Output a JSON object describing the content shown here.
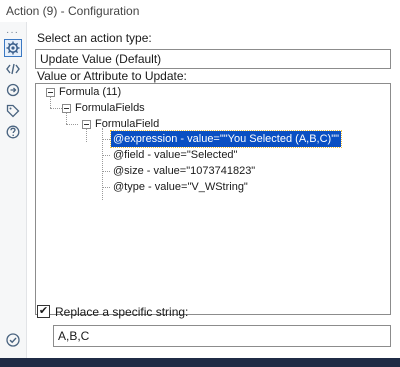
{
  "window": {
    "title": "Action (9) - Configuration"
  },
  "sidebar": {
    "items": [
      {
        "icon": "gear-icon",
        "active": true
      },
      {
        "icon": "code-icon",
        "active": false
      },
      {
        "icon": "connection-icon",
        "active": false
      },
      {
        "icon": "tag-icon",
        "active": false
      },
      {
        "icon": "help-icon",
        "active": false
      }
    ]
  },
  "action_type": {
    "label": "Select an action type:",
    "selected": "Update Value (Default)"
  },
  "tree": {
    "label": "Value or Attribute to Update:",
    "nodes": [
      {
        "text": "Formula (11)"
      },
      {
        "text": "FormulaFields"
      },
      {
        "text": "FormulaField"
      },
      {
        "text": "@expression - value=\"\"You Selected (A,B,C)\"\"",
        "selected": true
      },
      {
        "text": "@field - value=\"Selected\""
      },
      {
        "text": "@size - value=\"1073741823\""
      },
      {
        "text": "@type - value=\"V_WString\""
      }
    ]
  },
  "replace": {
    "checked": true,
    "check_mark": "✔",
    "label": "Replace a specific string:",
    "value": "A,B,C"
  },
  "colors": {
    "accent": "#0a4fc3",
    "bottom_bar": "#1f2b45"
  }
}
